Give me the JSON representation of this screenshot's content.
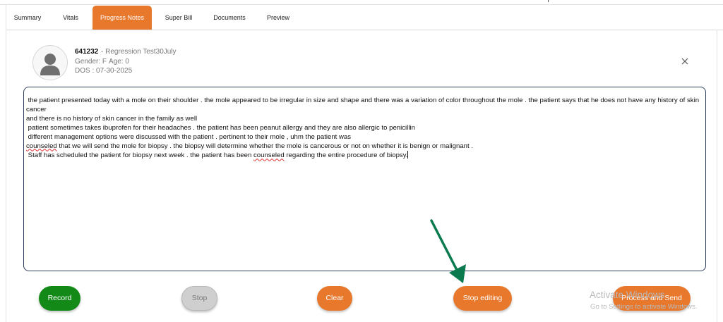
{
  "tabs": [
    {
      "label": "Summary"
    },
    {
      "label": "Vitals"
    },
    {
      "label": "Progress Notes",
      "active": true
    },
    {
      "label": "Super Bill"
    },
    {
      "label": "Documents"
    },
    {
      "label": "Preview"
    }
  ],
  "patient": {
    "id": "641232",
    "name": "- Regression Test30July",
    "gender": "Gender: F",
    "age": "Age: 0",
    "dos": "DOS : 07-30-2025"
  },
  "note": {
    "line1": " the patient presented today with a mole on their shoulder . the mole appeared to be irregular in size and shape and there was a variation of color throughout the mole . the patient says that he does not have any history of skin cancer",
    "line2": "and there is no history of skin cancer in the family as well",
    "line3": " patient sometimes takes ibuprofen for their headaches . the patient has been peanut allergy and they are also allergic to penicillin",
    "line4": " different management options were discussed with the patient . pertinent to their mole , uhm the patient was",
    "line5_word": "counseled",
    "line5_rest": " that we will send the mole for biopsy . the biopsy will determine whether the mole is cancerous or not on whether it is benign or malignant .",
    "line6_a": " Staff has scheduled the patient for biopsy next week . the patient has been ",
    "line6_word": "counseled",
    "line6_b": " regarding the entire procedure of biopsy."
  },
  "buttons": {
    "record": "Record",
    "stop": "Stop",
    "clear": "Clear",
    "stop_editing": "Stop editing",
    "process_send": "Process and Send"
  },
  "watermark": {
    "title": "Activate Windows",
    "subtitle": "Go to Settings to activate Windows."
  },
  "colors": {
    "accent": "#e8782c",
    "record": "#138a17",
    "annotation_arrow": "#0b7a4f"
  },
  "icons": {
    "avatar": "user-silhouette-icon",
    "close": "close-icon",
    "annotation": "annotation-arrow-icon"
  }
}
